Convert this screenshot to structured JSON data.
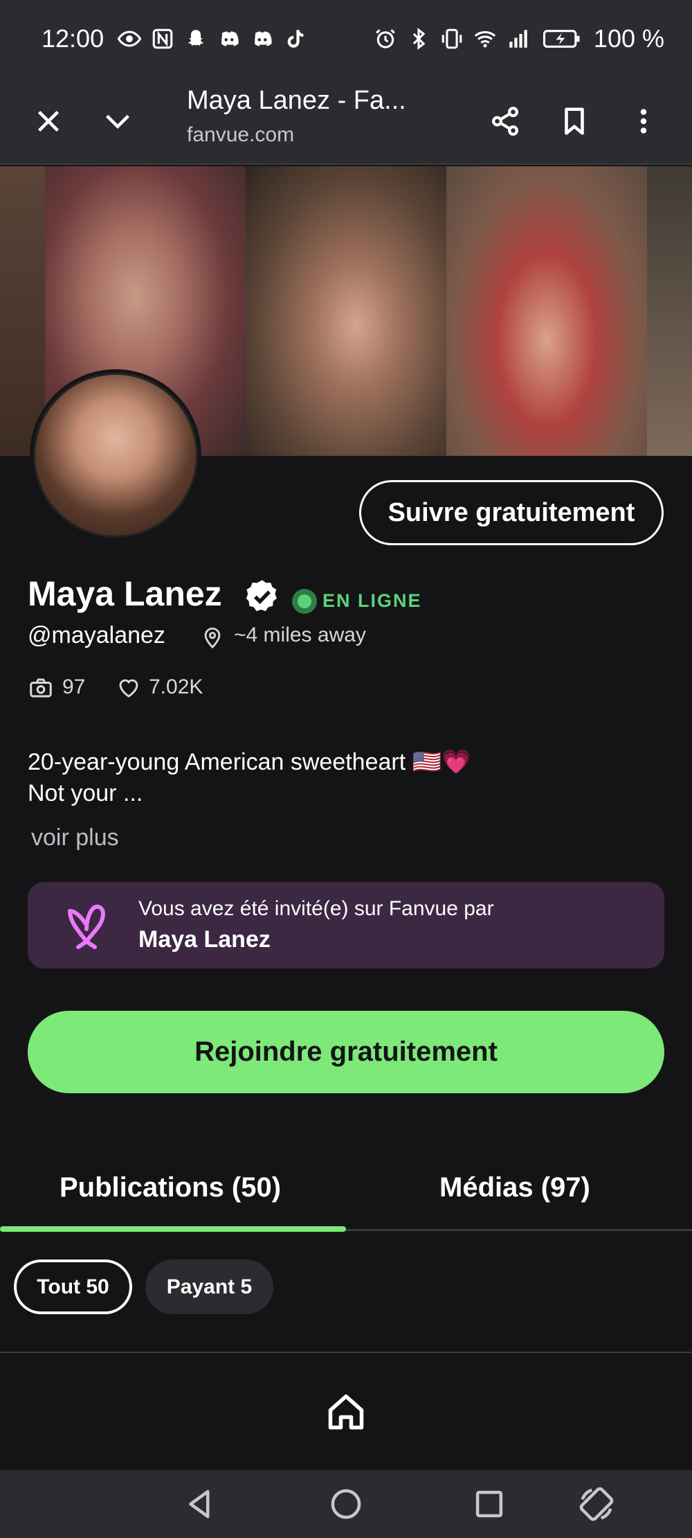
{
  "status_bar": {
    "time": "12:00",
    "battery": "100 %"
  },
  "browser": {
    "title": "Maya Lanez - Fa...",
    "url": "fanvue.com"
  },
  "profile": {
    "follow_label": "Suivre gratuitement",
    "name": "Maya Lanez",
    "online_label": "EN LIGNE",
    "handle": "@mayalanez",
    "distance": "~4 miles away",
    "photos_count": "97",
    "likes_count": "7.02K",
    "bio_line1": "20-year-young American sweetheart 🇺🇸💗",
    "bio_line2": "Not your ...",
    "see_more": "voir plus"
  },
  "invite": {
    "line1": "Vous avez été invité(e) sur Fanvue par",
    "inviter": "Maya Lanez"
  },
  "join_label": "Rejoindre gratuitement",
  "tabs": [
    {
      "label": "Publications (50)",
      "active": true
    },
    {
      "label": "Médias (97)",
      "active": false
    }
  ],
  "filters": [
    {
      "label": "Tout 50",
      "active": true
    },
    {
      "label": "Payant 5",
      "active": false
    }
  ],
  "colors": {
    "accent": "#7ce978",
    "online": "#5fd17b",
    "invite_bg": "#3c2843",
    "logo": "#e879f9"
  }
}
